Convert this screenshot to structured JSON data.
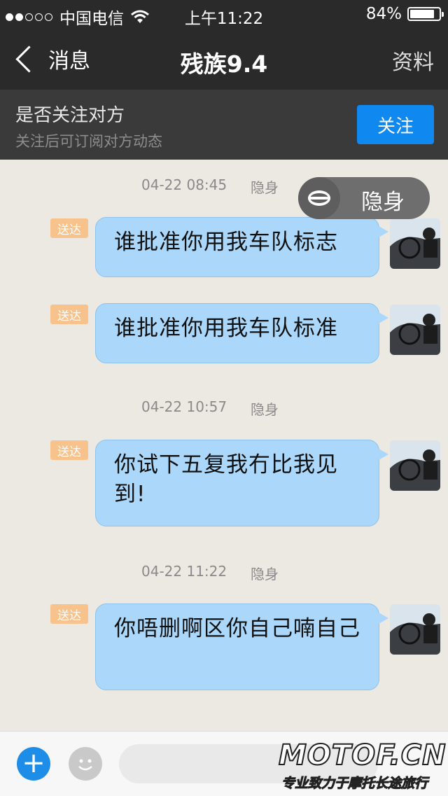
{
  "status_bar": {
    "carrier": "中国电信",
    "time": "上午11:22",
    "battery_text": "84%",
    "battery_level": 0.84
  },
  "nav": {
    "back_label": "消息",
    "title": "残族9.4",
    "right_label": "资料"
  },
  "follow_prompt": {
    "title": "是否关注对方",
    "subtitle": "关注后可订阅对方动态",
    "button_label": "关注"
  },
  "invisible_button": {
    "label": "隐身"
  },
  "messages": [
    {
      "time": "04-22 08:45",
      "status": "隐身",
      "badge": "送达",
      "text": "谁批准你用我车队标志"
    },
    {
      "badge": "送达",
      "text": "谁批准你用我车队标准"
    },
    {
      "time": "04-22 10:57",
      "status": "隐身",
      "badge": "送达",
      "text": "你试下五复我冇比我见到!"
    },
    {
      "time": "04-22 11:22",
      "status": "隐身",
      "badge": "送达",
      "text": "你唔删啊区你自己喃自己"
    }
  ],
  "input_bar": {
    "placeholder": ""
  },
  "watermark": {
    "main": "MOTOF.CN",
    "sub": "专业致力于摩托长途旅行"
  },
  "colors": {
    "bubble": "#aad7fa",
    "follow_button": "#0f88f0",
    "badge": "#f7c28c"
  }
}
